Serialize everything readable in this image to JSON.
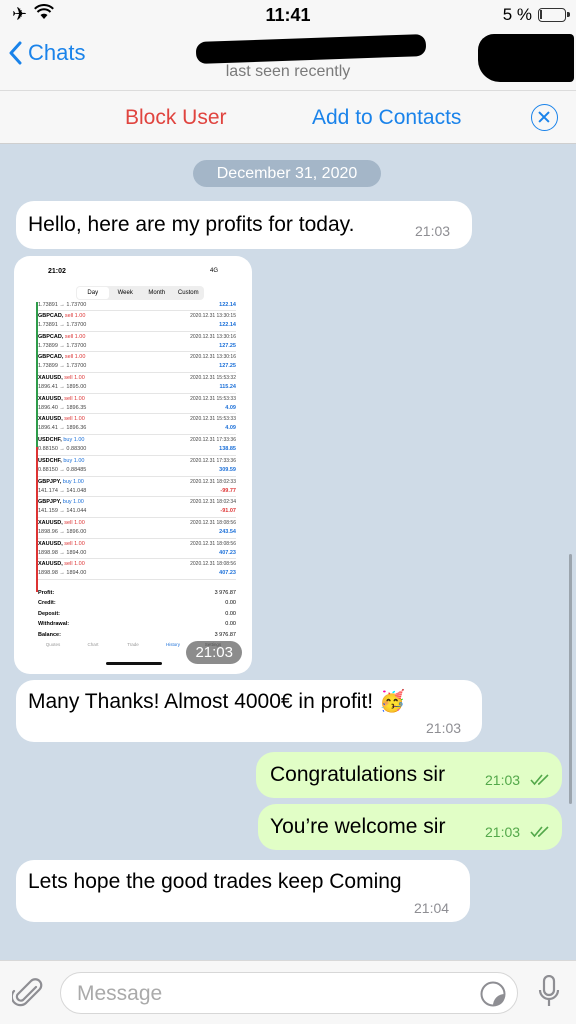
{
  "status_bar": {
    "time": "11:41",
    "battery": "5 %"
  },
  "nav": {
    "back_label": "Chats",
    "subtitle": "last seen recently"
  },
  "actions": {
    "block": "Block User",
    "add": "Add to Contacts"
  },
  "chat": {
    "date": "December 31, 2020",
    "messages": [
      {
        "dir": "in",
        "text": "Hello, here are my profits for today.",
        "time": "21:03"
      },
      {
        "dir": "in",
        "type": "image",
        "time": "21:03"
      },
      {
        "dir": "in",
        "text": "Many Thanks! Almost 4000€ in profit! 🥳",
        "time": "21:03"
      },
      {
        "dir": "out",
        "text": "Congratulations sir",
        "time": "21:03",
        "read": true
      },
      {
        "dir": "out",
        "text": "You’re welcome sir",
        "time": "21:03",
        "read": true
      },
      {
        "dir": "in",
        "text": "Lets hope the good trades keep Coming",
        "time": "21:04"
      }
    ]
  },
  "image_screenshot": {
    "status_time": "21:02",
    "network": "4G",
    "tabs": [
      "Day",
      "Week",
      "Month",
      "Custom"
    ],
    "active_tab": "Day",
    "first_row_partial": {
      "price": "1.73891 → 1.73700",
      "pl": "122.14"
    },
    "rows": [
      {
        "symbol": "GBPCAD,",
        "side": "sell 1.00",
        "price": "1.73891 → 1.73700",
        "datetime": "2020.12.31 13:30:15",
        "pl": "122.14"
      },
      {
        "symbol": "GBPCAD,",
        "side": "sell 1.00",
        "price": "1.73899 → 1.73700",
        "datetime": "2020.12.31 13:30:16",
        "pl": "127.25"
      },
      {
        "symbol": "GBPCAD,",
        "side": "sell 1.00",
        "price": "1.73899 → 1.73700",
        "datetime": "2020.12.31 13:30:16",
        "pl": "127.25"
      },
      {
        "symbol": "XAUUSD,",
        "side": "sell 1.00",
        "price": "1896.41 → 1895.00",
        "datetime": "2020.12.31 15:53:32",
        "pl": "115.24"
      },
      {
        "symbol": "XAUUSD,",
        "side": "sell 1.00",
        "price": "1896.40 → 1896.35",
        "datetime": "2020.12.31 15:53:33",
        "pl": "4.09"
      },
      {
        "symbol": "XAUUSD,",
        "side": "sell 1.00",
        "price": "1896.41 → 1896.36",
        "datetime": "2020.12.31 15:53:33",
        "pl": "4.09"
      },
      {
        "symbol": "USDCHF,",
        "side": "buy 1.00",
        "price": "0.88150 → 0.88300",
        "datetime": "2020.12.31 17:33:36",
        "pl": "138.85"
      },
      {
        "symbol": "USDCHF,",
        "side": "buy 1.00",
        "price": "0.88150 → 0.88485",
        "datetime": "2020.12.31 17:33:36",
        "pl": "309.59"
      },
      {
        "symbol": "GBPJPY,",
        "side": "buy 1.00",
        "price": "141.174 → 141.048",
        "datetime": "2020.12.31 18:02:33",
        "pl": "-99.77"
      },
      {
        "symbol": "GBPJPY,",
        "side": "buy 1.00",
        "price": "141.159 → 141.044",
        "datetime": "2020.12.31 18:02:34",
        "pl": "-91.07"
      },
      {
        "symbol": "XAUUSD,",
        "side": "sell 1.00",
        "price": "1898.96 → 1896.00",
        "datetime": "2020.12.31 18:08:56",
        "pl": "243.54"
      },
      {
        "symbol": "XAUUSD,",
        "side": "sell 1.00",
        "price": "1898.98 → 1894.00",
        "datetime": "2020.12.31 18:08:56",
        "pl": "407.23"
      },
      {
        "symbol": "XAUUSD,",
        "side": "sell 1.00",
        "price": "1898.98 → 1894.00",
        "datetime": "2020.12.31 18:08:56",
        "pl": "407.23"
      }
    ],
    "summary": [
      {
        "label": "Profit:",
        "value": "3 976.87"
      },
      {
        "label": "Credit:",
        "value": "0.00"
      },
      {
        "label": "Deposit:",
        "value": "0.00"
      },
      {
        "label": "Withdrawal:",
        "value": "0.00"
      },
      {
        "label": "Balance:",
        "value": "3 976.87"
      }
    ],
    "bottom_tabs": [
      "Quotes",
      "Chart",
      "Trade",
      "History",
      "Settings"
    ],
    "active_bottom_tab": "History"
  },
  "input": {
    "placeholder": "Message"
  },
  "colors": {
    "accent": "#1a83ea",
    "danger": "#e0443f",
    "outgoing_bubble": "#e1fec6",
    "chat_bg": "#cfdbe7"
  }
}
